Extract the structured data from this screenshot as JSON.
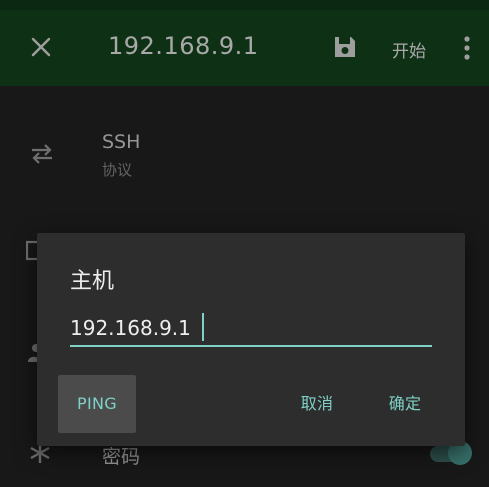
{
  "appbar": {
    "title": "192.168.9.1",
    "start_label": "开始",
    "close_icon": "close-icon",
    "save_icon": "save-icon",
    "more_icon": "more-vert-icon"
  },
  "list": {
    "protocol": {
      "title": "SSH",
      "subtitle": "协议",
      "icon": "swap-arrows-icon"
    },
    "password": {
      "title": "密码",
      "icon": "asterisk-icon"
    }
  },
  "dialog": {
    "title": "主机",
    "host_value": "192.168.9.1",
    "ping_label": "PING",
    "cancel_label": "取消",
    "ok_label": "确定"
  },
  "colors": {
    "appbar": "#14451f",
    "accent": "#7fd0c7",
    "dialog_bg": "#2d2d2d"
  }
}
